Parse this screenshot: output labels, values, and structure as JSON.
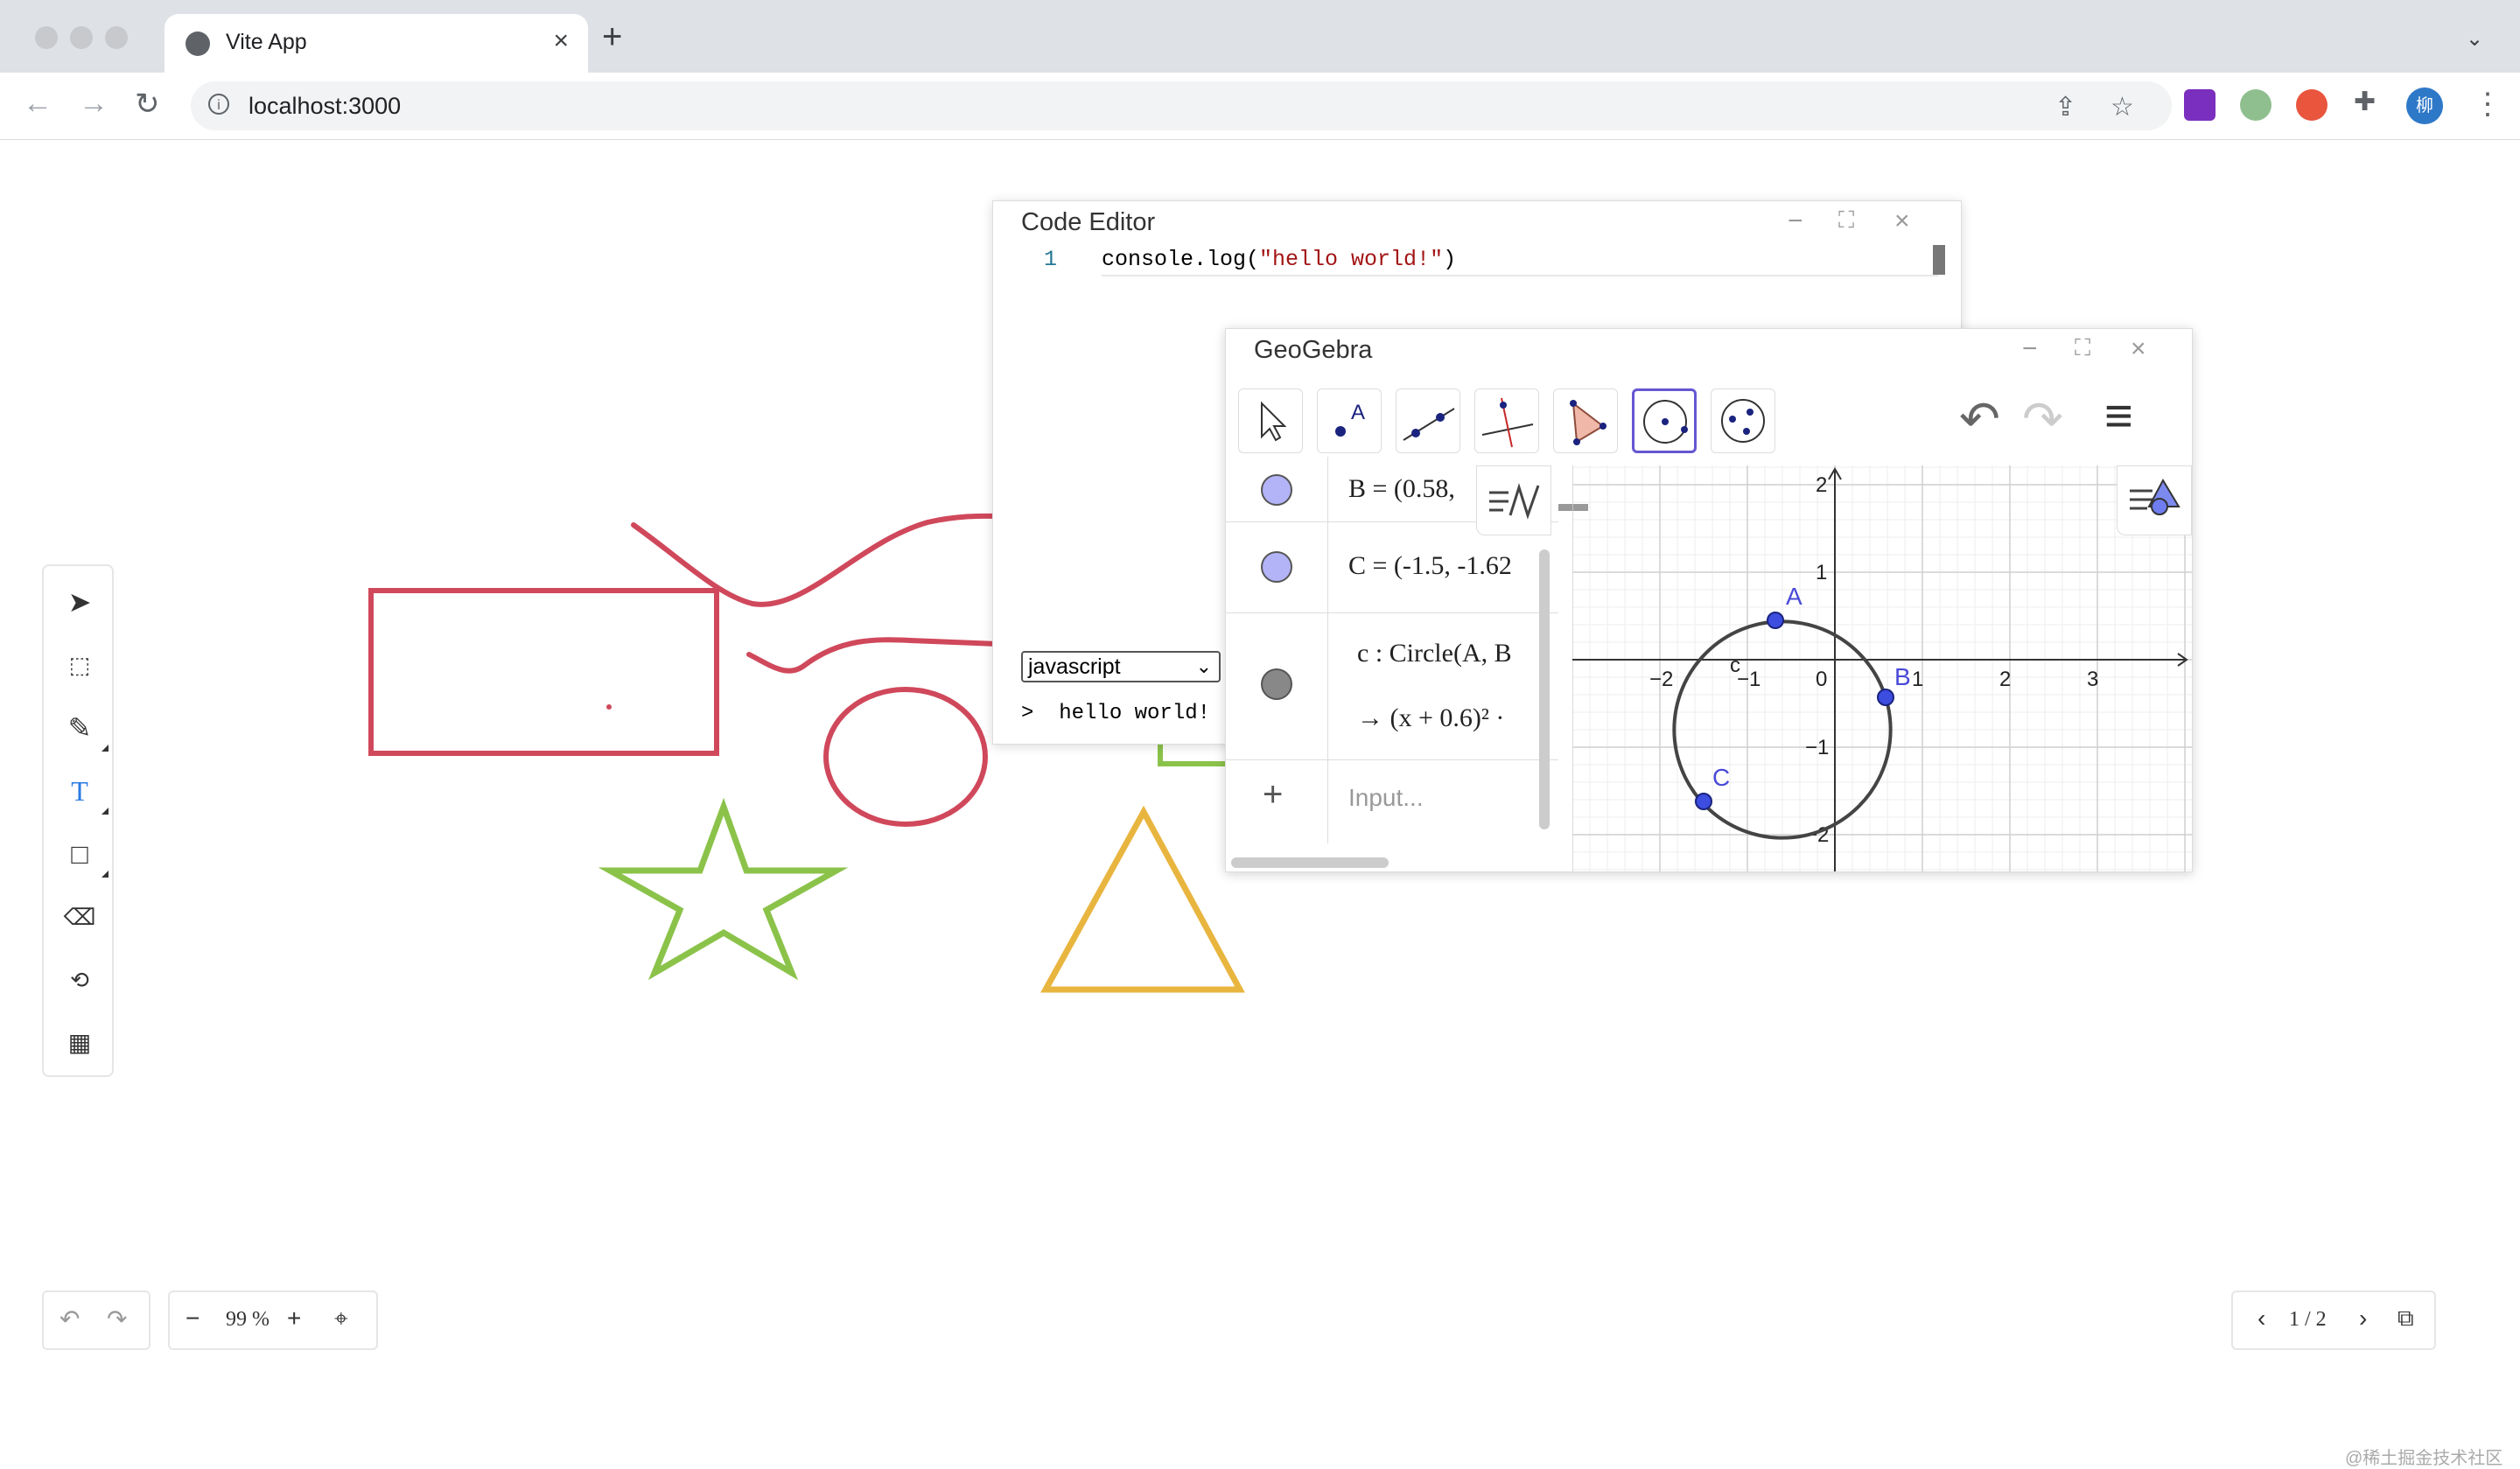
{
  "browser": {
    "tab_title": "Vite App",
    "tab_close": "×",
    "new_tab": "+",
    "tab_menu": "⌄",
    "url": "localhost:3000",
    "profile_initial": "柳"
  },
  "whiteboard": {
    "zoom": "99 %",
    "page": "1 / 2",
    "watermark": "@稀土掘金技术社区"
  },
  "code_editor": {
    "title": "Code Editor",
    "line_number": "1",
    "code_prefix": "console.log(",
    "code_string": "\"hello world!\"",
    "code_suffix": ")",
    "language": "javascript",
    "output": ">  hello world!"
  },
  "geogebra": {
    "title": "GeoGebra",
    "algebra": [
      {
        "text": "B = (0.58,",
        "color": "#b3b3f7"
      },
      {
        "text": "C = (-1.5, ‑1.62",
        "color": "#b3b3f7"
      },
      {
        "text": "c : Circle(A, B",
        "subtext": "→ (x + 0.6)² ·",
        "color": "#888888"
      }
    ],
    "input_placeholder": "Input...",
    "axis_x_labels": [
      "−2",
      "−1",
      "0",
      "1",
      "2",
      "3"
    ],
    "axis_y_labels": [
      "2",
      "1",
      "−1",
      "−2"
    ],
    "point_labels": [
      "A",
      "B",
      "C"
    ],
    "circle_label": "c"
  },
  "colors": {
    "red_stroke": "#d0485b",
    "green_stroke": "#8bc34a",
    "yellow_stroke": "#e8b53f",
    "geo_point": "#3c4de0",
    "geo_accent": "#6557d2"
  }
}
